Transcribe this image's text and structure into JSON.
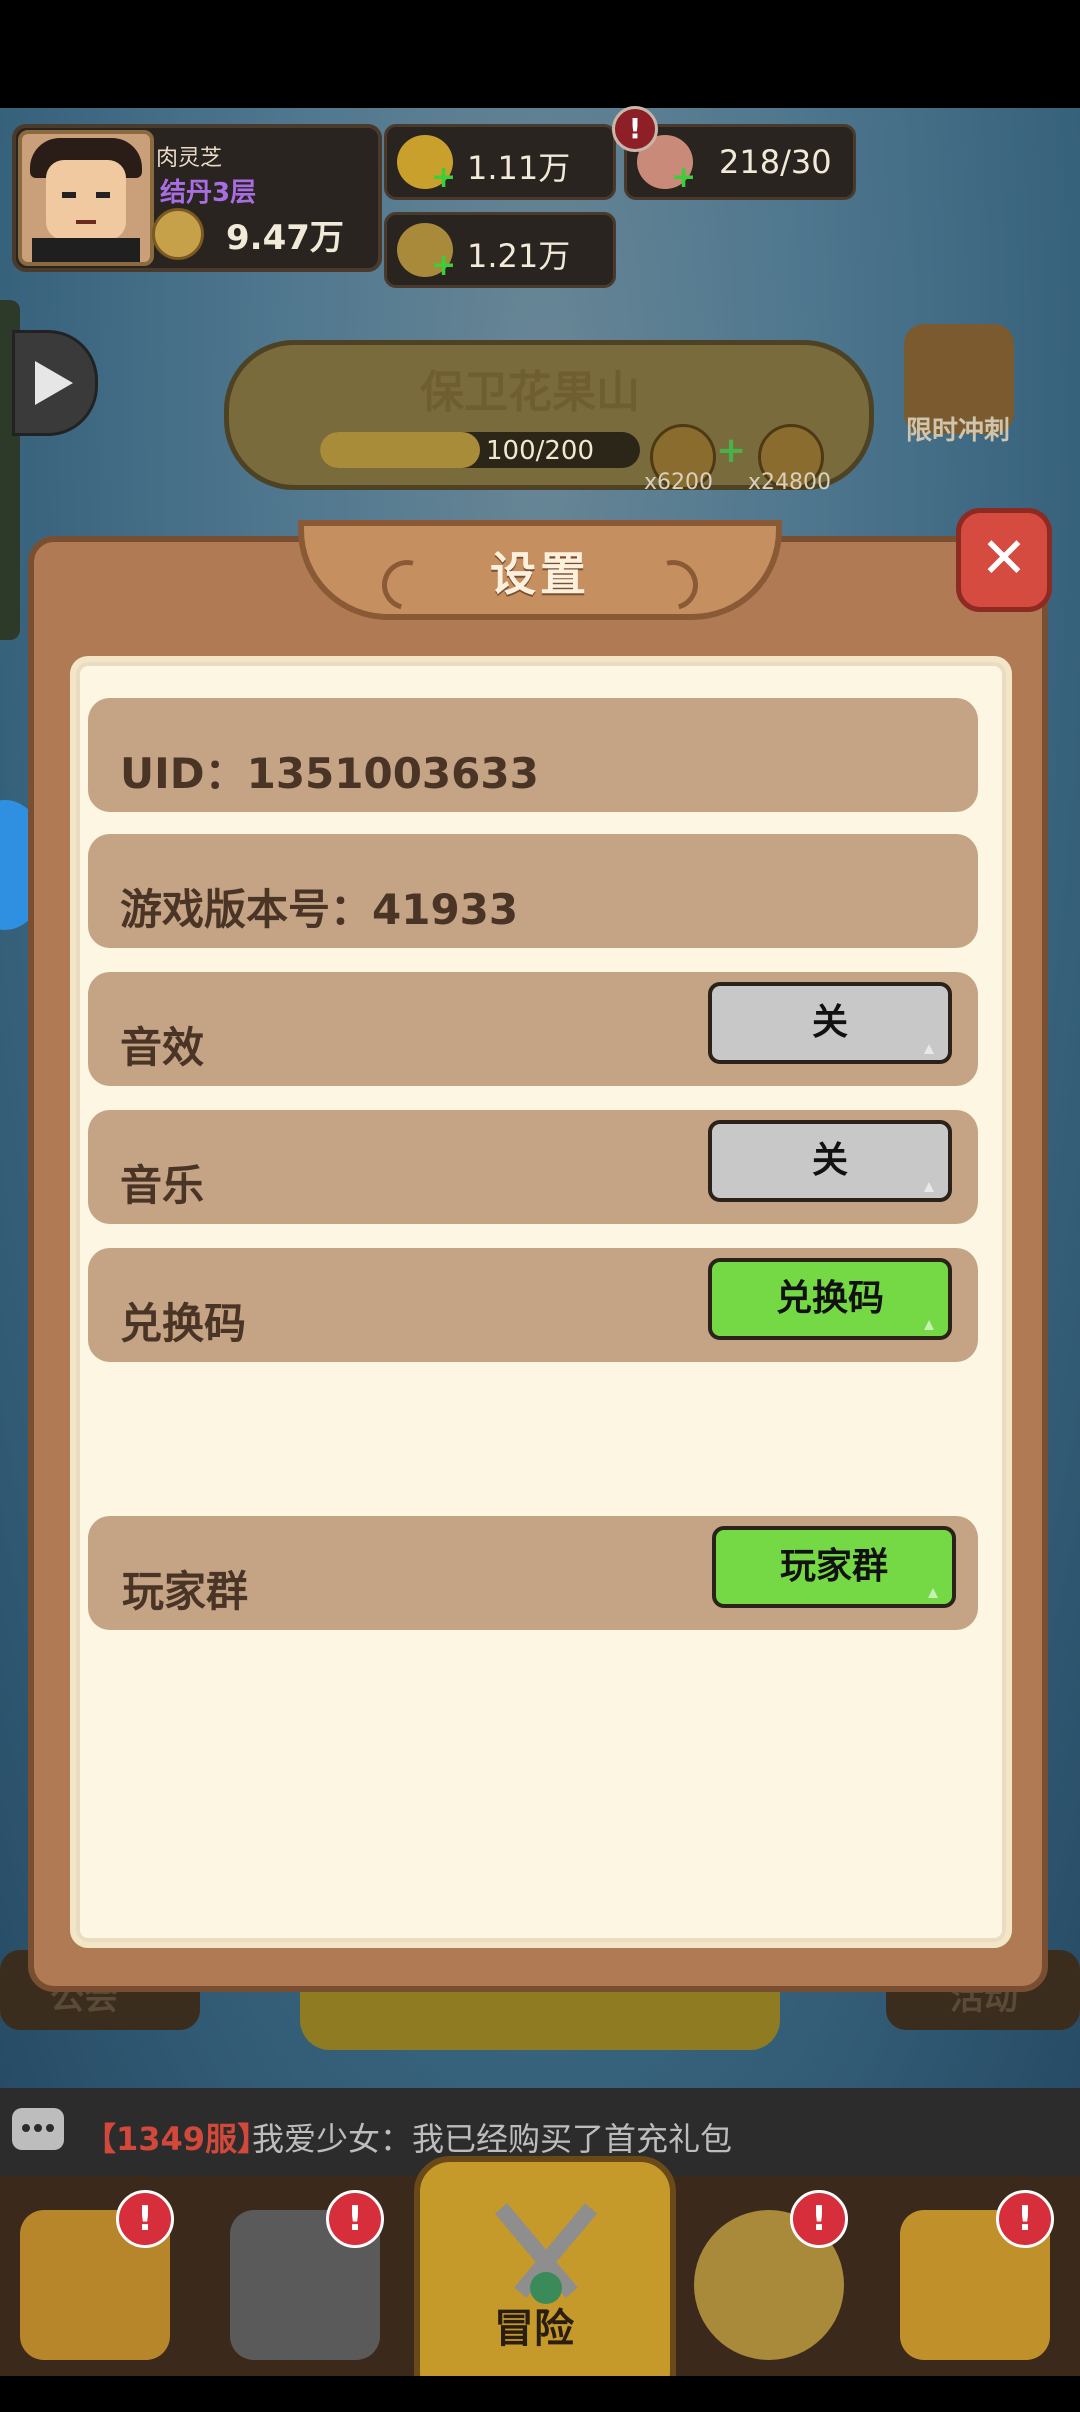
{
  "player": {
    "name": "肉灵芝",
    "rank": "结丹3层",
    "power": "9.47万"
  },
  "resources": {
    "gold": "1.11万",
    "coins": "1.21万",
    "stamina": "218/30"
  },
  "event": {
    "title": "保卫花果山",
    "progress": "100/200",
    "reward1": "x6200",
    "reward2": "x24800",
    "limit_label": "限时冲刺"
  },
  "background_labels": {
    "left": "公会",
    "right": "活动"
  },
  "chat": {
    "server": "【1349服】",
    "message": "我爱少女：我已经购买了首充礼包"
  },
  "nav": {
    "adventure": "冒险",
    "badge": "!"
  },
  "dialog": {
    "title": "设置",
    "close_icon": "close-x",
    "uid": "UID：1351003633",
    "version": "游戏版本号：41933",
    "rows": [
      {
        "label": "音效",
        "button": "关",
        "state": "off"
      },
      {
        "label": "音乐",
        "button": "关",
        "state": "off"
      },
      {
        "label": "兑换码",
        "button": "兑换码",
        "state": "action"
      },
      {
        "label": "玩家群",
        "button": "玩家群",
        "state": "action"
      }
    ]
  },
  "colors": {
    "dialog_frame": "#b07a54",
    "dialog_inner": "#fdf6e3",
    "row_bg": "#c4a485",
    "toggle_off": "#c8c8c8",
    "toggle_on": "#74d944",
    "close_red": "#d64b40"
  }
}
